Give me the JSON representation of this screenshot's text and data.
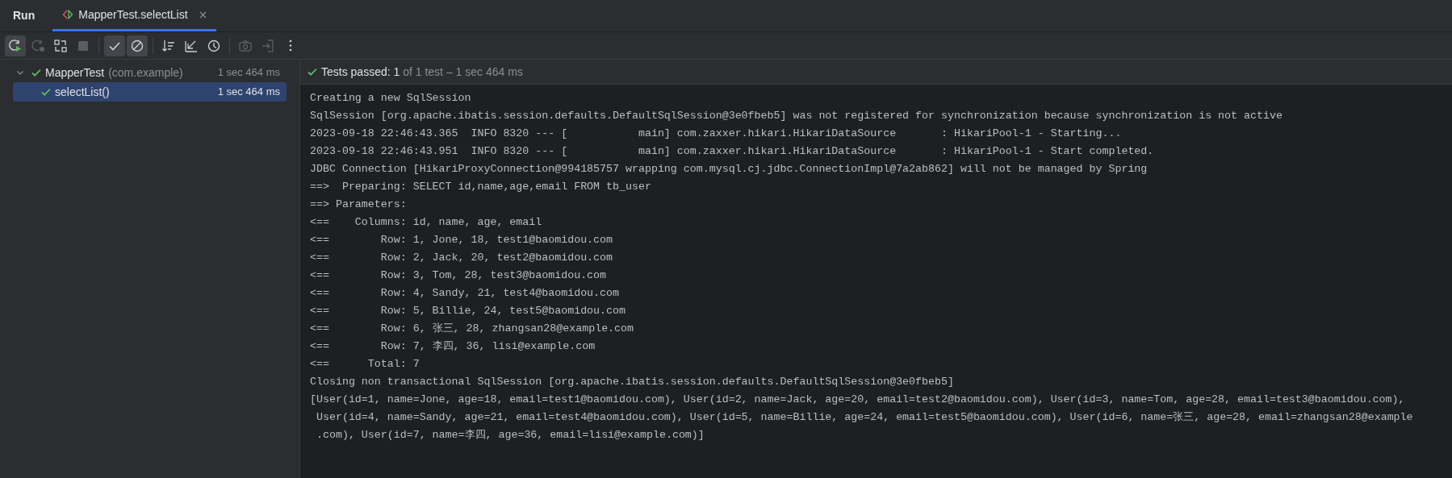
{
  "tool_window": {
    "title": "Run"
  },
  "tabs": [
    {
      "label": "MapperTest.selectList",
      "selected": true
    }
  ],
  "toolbar": [
    {
      "kind": "rerun",
      "selected": true,
      "disabled": false
    },
    {
      "kind": "rerun-failed",
      "selected": false,
      "disabled": true
    },
    {
      "kind": "toggle-auto",
      "selected": false,
      "disabled": false
    },
    {
      "kind": "stop",
      "selected": false,
      "disabled": true
    },
    {
      "kind": "sep"
    },
    {
      "kind": "show-passed",
      "selected": true,
      "disabled": false
    },
    {
      "kind": "show-ignored",
      "selected": true,
      "disabled": false
    },
    {
      "kind": "sep"
    },
    {
      "kind": "sort",
      "selected": false,
      "disabled": false
    },
    {
      "kind": "collapse",
      "selected": false,
      "disabled": false
    },
    {
      "kind": "history",
      "selected": false,
      "disabled": false
    },
    {
      "kind": "sep"
    },
    {
      "kind": "screenshot",
      "selected": false,
      "disabled": true
    },
    {
      "kind": "import",
      "selected": false,
      "disabled": true
    },
    {
      "kind": "more",
      "selected": false,
      "disabled": false
    }
  ],
  "tree": [
    {
      "name": "MapperTest",
      "package": "(com.example)",
      "time": "1 sec 464 ms",
      "expanded": true,
      "selected": false,
      "children": [
        {
          "name": "selectList()",
          "time": "1 sec 464 ms",
          "selected": true
        }
      ]
    }
  ],
  "status": {
    "label": "Tests passed:",
    "count": "1",
    "detail": "of 1 test – 1 sec 464 ms"
  },
  "console": [
    "Creating a new SqlSession",
    "SqlSession [org.apache.ibatis.session.defaults.DefaultSqlSession@3e0fbeb5] was not registered for synchronization because synchronization is not active",
    "2023-09-18 22:46:43.365  INFO 8320 --- [           main] com.zaxxer.hikari.HikariDataSource       : HikariPool-1 - Starting...",
    "2023-09-18 22:46:43.951  INFO 8320 --- [           main] com.zaxxer.hikari.HikariDataSource       : HikariPool-1 - Start completed.",
    "JDBC Connection [HikariProxyConnection@994185757 wrapping com.mysql.cj.jdbc.ConnectionImpl@7a2ab862] will not be managed by Spring",
    "==>  Preparing: SELECT id,name,age,email FROM tb_user",
    "==> Parameters: ",
    "<==    Columns: id, name, age, email",
    "<==        Row: 1, Jone, 18, test1@baomidou.com",
    "<==        Row: 2, Jack, 20, test2@baomidou.com",
    "<==        Row: 3, Tom, 28, test3@baomidou.com",
    "<==        Row: 4, Sandy, 21, test4@baomidou.com",
    "<==        Row: 5, Billie, 24, test5@baomidou.com",
    "<==        Row: 6, 张三, 28, zhangsan28@example.com",
    "<==        Row: 7, 李四, 36, lisi@example.com",
    "<==      Total: 7",
    "Closing non transactional SqlSession [org.apache.ibatis.session.defaults.DefaultSqlSession@3e0fbeb5]",
    "[User(id=1, name=Jone, age=18, email=test1@baomidou.com), User(id=2, name=Jack, age=20, email=test2@baomidou.com), User(id=3, name=Tom, age=28, email=test3@baomidou.com),",
    " User(id=4, name=Sandy, age=21, email=test4@baomidou.com), User(id=5, name=Billie, age=24, email=test5@baomidou.com), User(id=6, name=张三, age=28, email=zhangsan28@example",
    " .com), User(id=7, name=李四, age=36, email=lisi@example.com)]"
  ]
}
